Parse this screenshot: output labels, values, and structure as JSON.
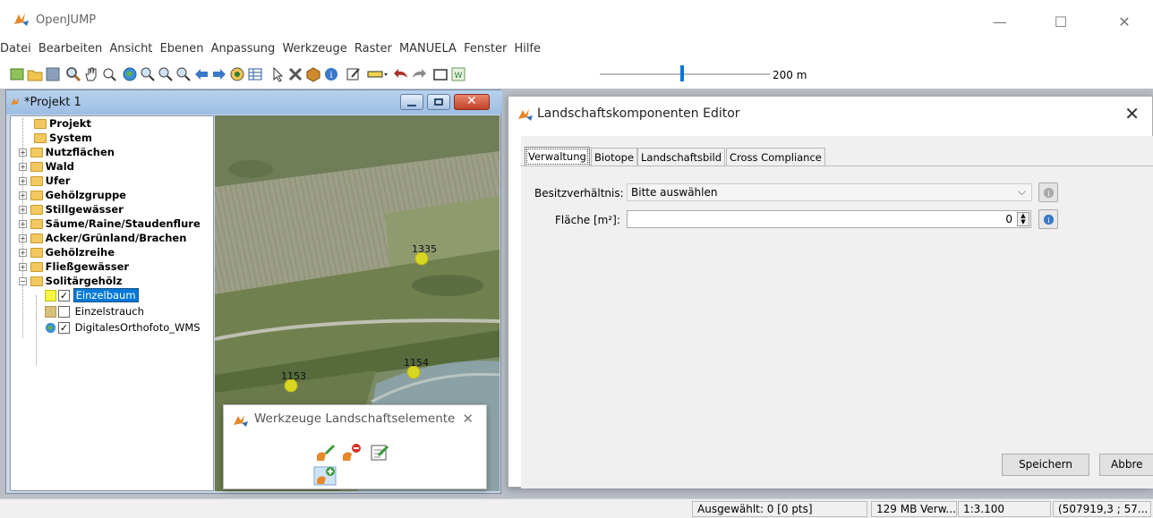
{
  "app": {
    "title": "OpenJUMP",
    "minimize": "—",
    "maximize": "☐",
    "close": "✕"
  },
  "menu": [
    "Datei",
    "Bearbeiten",
    "Ansicht",
    "Ebenen",
    "Anpassung",
    "Werkzeuge",
    "Raster",
    "MANUELA",
    "Fenster",
    "Hilfe"
  ],
  "toolbar": {
    "scale_label": "200 m"
  },
  "project": {
    "title": "*Projekt 1",
    "tree": [
      {
        "label": "Projekt",
        "expander": ""
      },
      {
        "label": "System",
        "expander": ""
      },
      {
        "label": "Nutzflächen",
        "expander": "+"
      },
      {
        "label": "Wald",
        "expander": "+"
      },
      {
        "label": "Ufer",
        "expander": "+"
      },
      {
        "label": "Gehölzgruppe",
        "expander": "+"
      },
      {
        "label": "Stillgewässer",
        "expander": "+"
      },
      {
        "label": "Säume/Raine/Staudenflure",
        "expander": "+"
      },
      {
        "label": "Acker/Grünland/Brachen",
        "expander": "+"
      },
      {
        "label": "Gehölzreihe",
        "expander": "+"
      },
      {
        "label": "Fließgewässer",
        "expander": "+"
      },
      {
        "label": "Solitärgehölz",
        "expander": "−"
      }
    ],
    "layers": [
      {
        "label": "Einzelbaum",
        "checked": "✓",
        "selected": true
      },
      {
        "label": "Einzelstrauch",
        "checked": "",
        "selected": false
      },
      {
        "label": "DigitalesOrthofoto_WMS",
        "checked": "✓",
        "selected": false
      }
    ]
  },
  "map": {
    "points": [
      {
        "label": "1335"
      },
      {
        "label": "1153"
      },
      {
        "label": "1154"
      }
    ]
  },
  "tools_dialog": {
    "title": "Werkzeuge Landschaftselemente",
    "close": "✕"
  },
  "editor": {
    "title": "Landschaftskomponenten Editor",
    "close": "✕",
    "tabs": [
      "Verwaltung",
      "Biotope",
      "Landschaftsbild",
      "Cross Compliance"
    ],
    "active_tab": "Verwaltung",
    "ownership_label": "Besitzverhältnis:",
    "ownership_value": "Bitte auswählen",
    "area_label": "Fläche [m²]:",
    "area_value": "0",
    "save_label": "Speichern",
    "cancel_label": "Abbre"
  },
  "status": {
    "selected": "Ausgewählt: 0 [0 pts]",
    "memory": "129 MB Verw...",
    "scale": "1:3.100",
    "coords": "(507919,3 ; 57..."
  },
  "colors": {
    "point_fill": "#d9d622",
    "selection": "#0078d7",
    "frame_title": "#9cbde2"
  }
}
